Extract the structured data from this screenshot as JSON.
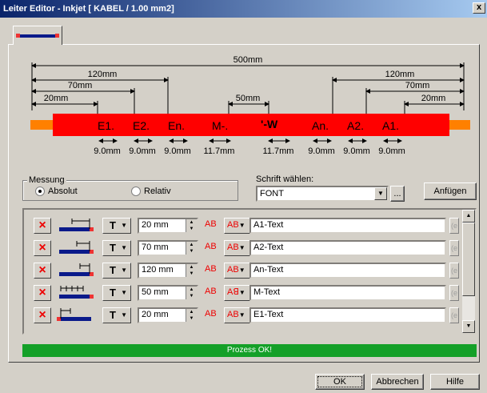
{
  "window": {
    "title": "Leiter Editor - Inkjet  [ KABEL / 1.00 mm2]",
    "close_glyph": "x"
  },
  "diagram": {
    "total_label": "500mm",
    "left_dims": [
      "120mm",
      "70mm",
      "20mm"
    ],
    "right_dims": [
      "120mm",
      "70mm",
      "20mm"
    ],
    "mid_dim": "50mm",
    "cable_labels": [
      "E1.",
      "E2.",
      "En.",
      "M-.",
      "'-W",
      "An.",
      "A2.",
      "A1."
    ],
    "width_labels": [
      "9.0mm",
      "9.0mm",
      "9.0mm",
      "11.7mm",
      "11.7mm",
      "9.0mm",
      "9.0mm",
      "9.0mm"
    ],
    "colors": {
      "cable": "#ff0000",
      "ends": "#ff8000"
    }
  },
  "measurement": {
    "group_label": "Messung",
    "option_absolute": "Absolut",
    "option_relative": "Relativ",
    "selected": "Absolut"
  },
  "font": {
    "label": "Schrift wählen:",
    "value": "FONT",
    "browse_label": "...",
    "append_label": "Anfügen"
  },
  "rows": [
    {
      "distance": "20 mm",
      "text": "A1-Text",
      "ab_flipped": false
    },
    {
      "distance": "70 mm",
      "text": "A2-Text",
      "ab_flipped": false
    },
    {
      "distance": "120 mm",
      "text": "An-Text",
      "ab_flipped": false
    },
    {
      "distance": "50 mm",
      "text": "M-Text",
      "ab_flipped": true
    },
    {
      "distance": "20 mm",
      "text": "E1-Text",
      "ab_flipped": false
    }
  ],
  "row_labels": {
    "delete": "×",
    "t": "T",
    "ab": "AB",
    "ab2": "AB",
    "ab2_flipped": "Aꓭ",
    "e": "(e"
  },
  "status": {
    "text": "Prozess OK!",
    "color": "#14a028"
  },
  "buttons": {
    "ok": "OK",
    "cancel": "Abbrechen",
    "help": "Hilfe"
  }
}
